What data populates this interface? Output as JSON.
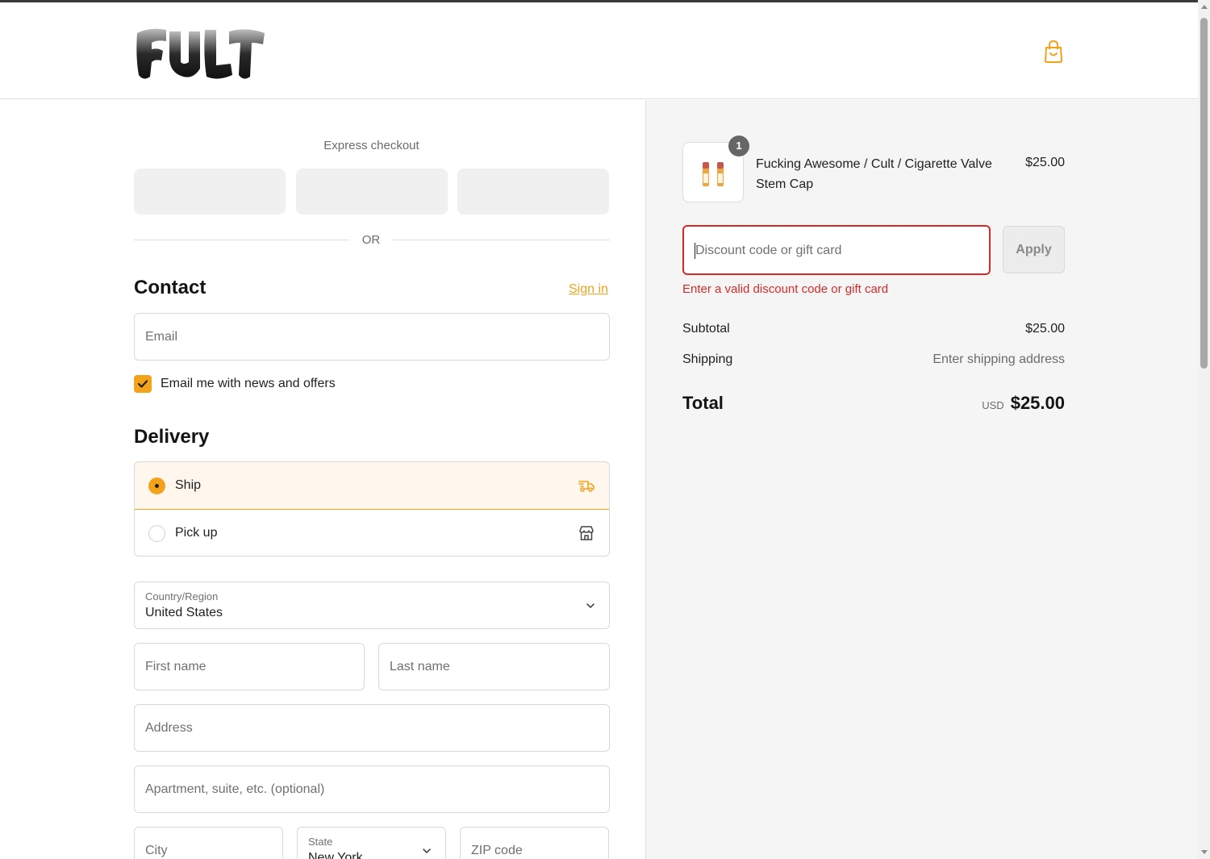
{
  "header": {
    "logo_alt": "CULT",
    "cart_icon": "shopping-bag-icon"
  },
  "express": {
    "title": "Express checkout",
    "or_label": "OR"
  },
  "contact": {
    "title": "Contact",
    "sign_in": "Sign in",
    "email_placeholder": "Email",
    "newsletter_label": "Email me with news and offers",
    "newsletter_checked": true
  },
  "delivery": {
    "title": "Delivery",
    "options": [
      {
        "label": "Ship",
        "selected": true,
        "icon": "truck-icon"
      },
      {
        "label": "Pick up",
        "selected": false,
        "icon": "store-icon"
      }
    ],
    "country_label": "Country/Region",
    "country_value": "United States",
    "first_name_placeholder": "First name",
    "last_name_placeholder": "Last name",
    "address_placeholder": "Address",
    "apartment_placeholder": "Apartment, suite, etc. (optional)",
    "city_placeholder": "City",
    "state_label": "State",
    "state_value": "New York",
    "zip_placeholder": "ZIP code"
  },
  "summary": {
    "item": {
      "name": "Fucking Awesome / Cult / Cigarette Valve Stem Cap",
      "price": "$25.00",
      "quantity": "1"
    },
    "discount_placeholder": "Discount code or gift card",
    "apply_label": "Apply",
    "discount_error": "Enter a valid discount code or gift card",
    "subtotal_label": "Subtotal",
    "subtotal_value": "$25.00",
    "shipping_label": "Shipping",
    "shipping_value": "Enter shipping address",
    "total_label": "Total",
    "total_currency": "USD",
    "total_value": "$25.00"
  },
  "colors": {
    "accent": "#f3a21b",
    "error": "#d62a2a",
    "summary_bg": "#f5f5f5"
  }
}
